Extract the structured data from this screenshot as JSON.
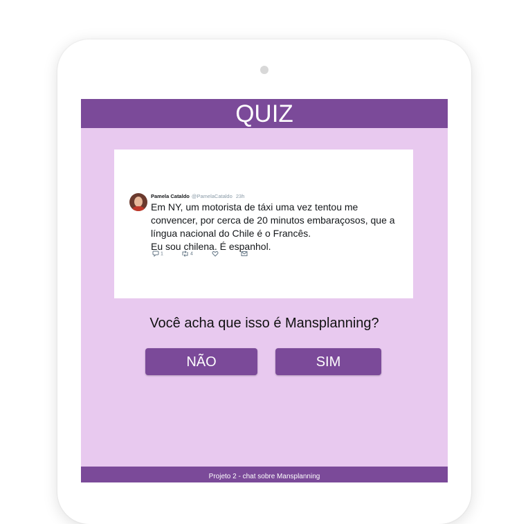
{
  "quiz": {
    "title": "QUIZ"
  },
  "tweet": {
    "name": "Pamela Cataldo",
    "handle": "@PamelaCataldo",
    "time": "23h",
    "lines": [
      "Em NY, um motorista de táxi uma vez tentou me",
      "convencer, por cerca de 20 minutos embaraçosos, que a",
      "língua nacional do Chile é o Francês.",
      "Eu sou chilena. É espanhol."
    ],
    "reply_count": "1",
    "retweet_count": "4"
  },
  "question": "Você acha que isso é Mansplanning?",
  "buttons": {
    "no_label": "NÃO",
    "yes_label": "SIM"
  },
  "footer": {
    "text": "Projeto 2 - chat sobre Mansplanning"
  },
  "colors": {
    "accent": "#7b4a99",
    "background": "#e8c9ef"
  },
  "icons": [
    "reply-icon",
    "retweet-icon",
    "like-icon",
    "message-icon"
  ]
}
